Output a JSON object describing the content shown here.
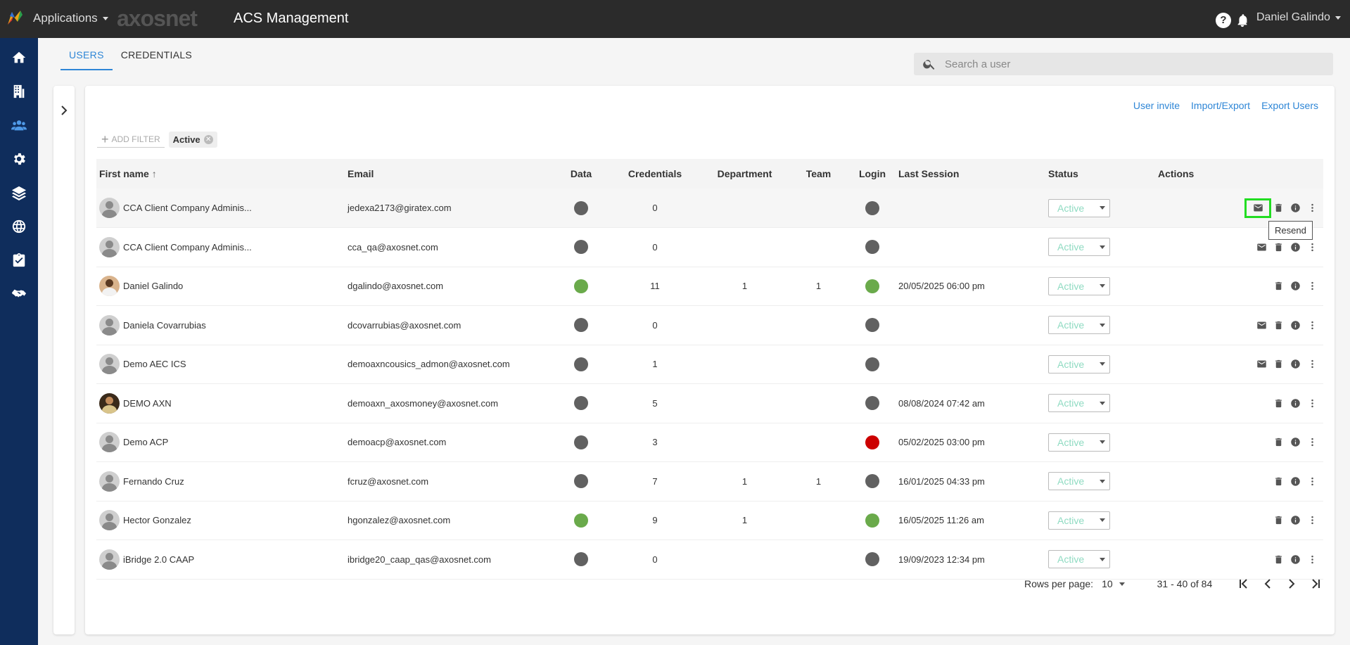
{
  "header": {
    "apps_label": "Applications",
    "brand": "axosnet",
    "title": "ACS Management",
    "help": "?",
    "user": "Daniel Galindo"
  },
  "sidebar": {
    "items": [
      {
        "icon": "home-icon"
      },
      {
        "icon": "building-icon"
      },
      {
        "icon": "users-icon",
        "active": true
      },
      {
        "icon": "gear-icon"
      },
      {
        "icon": "layers-icon"
      },
      {
        "icon": "globe-icon"
      },
      {
        "icon": "clipboard-check-icon"
      },
      {
        "icon": "handshake-icon"
      }
    ]
  },
  "tabs": [
    {
      "label": "USERS",
      "active": true
    },
    {
      "label": "CREDENTIALS",
      "active": false
    }
  ],
  "search": {
    "placeholder": "Search a user"
  },
  "top_links": {
    "invite": "User invite",
    "import_export": "Import/Export",
    "export": "Export Users"
  },
  "filters": {
    "add_label": "ADD FILTER",
    "chip": "Active"
  },
  "table": {
    "headers": {
      "first_name": "First name",
      "email": "Email",
      "data": "Data",
      "credentials": "Credentials",
      "department": "Department",
      "team": "Team",
      "login": "Login",
      "last_session": "Last Session",
      "status": "Status",
      "actions": "Actions"
    },
    "rows": [
      {
        "name": "CCA Client Company Adminis...",
        "email": "jedexa2173@giratex.com",
        "credentials": "0",
        "department": "",
        "team": "",
        "last_session": "",
        "status": "Active"
      },
      {
        "name": "CCA Client Company Adminis...",
        "email": "cca_qa@axosnet.com",
        "credentials": "0",
        "department": "",
        "team": "",
        "last_session": "",
        "status": "Active"
      },
      {
        "name": "Daniel Galindo",
        "email": "dgalindo@axosnet.com",
        "credentials": "11",
        "department": "1",
        "team": "1",
        "last_session": "20/05/2025 06:00 pm",
        "status": "Active"
      },
      {
        "name": "Daniela Covarrubias",
        "email": "dcovarrubias@axosnet.com",
        "credentials": "0",
        "department": "",
        "team": "",
        "last_session": "",
        "status": "Active"
      },
      {
        "name": "Demo AEC ICS",
        "email": "demoaxncousics_admon@axosnet.com",
        "credentials": "1",
        "department": "",
        "team": "",
        "last_session": "",
        "status": "Active"
      },
      {
        "name": "DEMO AXN",
        "email": "demoaxn_axosmoney@axosnet.com",
        "credentials": "5",
        "department": "",
        "team": "",
        "last_session": "08/08/2024 07:42 am",
        "status": "Active"
      },
      {
        "name": "Demo ACP",
        "email": "demoacp@axosnet.com",
        "credentials": "3",
        "department": "",
        "team": "",
        "last_session": "05/02/2025 03:00 pm",
        "status": "Active"
      },
      {
        "name": "Fernando Cruz",
        "email": "fcruz@axosnet.com",
        "credentials": "7",
        "department": "1",
        "team": "1",
        "last_session": "16/01/2025 04:33 pm",
        "status": "Active"
      },
      {
        "name": "Hector Gonzalez",
        "email": "hgonzalez@axosnet.com",
        "credentials": "9",
        "department": "1",
        "team": "",
        "last_session": "16/05/2025 11:26 am",
        "status": "Active"
      },
      {
        "name": "iBridge 2.0 CAAP",
        "email": "ibridge20_caap_qas@axosnet.com",
        "credentials": "0",
        "department": "",
        "team": "",
        "last_session": "19/09/2023 12:34 pm",
        "status": "Active"
      }
    ]
  },
  "tooltip": "Resend",
  "pagination": {
    "rows_label": "Rows per page:",
    "rows_value": "10",
    "range": "31 - 40 of 84"
  },
  "colors": {
    "accent": "#2e86d6",
    "sidebar": "#0f2d5c",
    "topbar": "#2b2b2b",
    "status_text": "#8fdbc2",
    "dot_gray": "#616161",
    "dot_green": "#6aaa4b",
    "dot_red": "#cc0000"
  }
}
